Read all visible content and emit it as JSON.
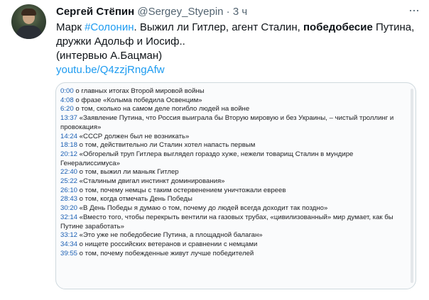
{
  "tweet": {
    "author_name": "Сергей Стёпин",
    "handle": "@Sergey_Styepin",
    "separator": "·",
    "time": "3 ч",
    "more_icon": "ellipsis-icon",
    "line1_a": "Марк ",
    "line1_hashtag": "#Солонин",
    "line1_b": ". Выжил ли Гитлер, агент Сталин, ",
    "line1_bold": "победобесие",
    "line1_c": " Путина,",
    "line2": "дружки Адольф и Иосиф..",
    "line3": "(интервью А.Бацман)",
    "link": "youtu.be/Q4zzjRngAfw"
  },
  "timestamps": [
    {
      "time": "0:00",
      "text": " о главных итогах Второй мировой войны"
    },
    {
      "time": "4:08",
      "text": " о фразе «Колыма победила Освенцим»"
    },
    {
      "time": "6:20",
      "text": " о том, сколько на самом деле погибло людей на войне"
    },
    {
      "time": "13:37",
      "text": " «Заявление Путина, что Россия выиграла бы Вторую мировую и без Украины, – чистый троллинг и провокация»"
    },
    {
      "time": "14:24",
      "text": " «СССР должен был не возникать»"
    },
    {
      "time": "18:18",
      "text": " о том, действительно ли Сталин хотел напасть первым"
    },
    {
      "time": "20:12",
      "text": " «Обгорелый труп Гитлера выглядел гораздо хуже, нежели товарищ Сталин в мундире Генералиссимуса»"
    },
    {
      "time": "22:40",
      "text": " о том, выжил ли маньяк Гитлер"
    },
    {
      "time": "25:22",
      "text": " «Сталиным двигал инстинкт доминирования»"
    },
    {
      "time": "26:10",
      "text": " о том, почему немцы с таким остервенением уничтожали евреев"
    },
    {
      "time": "28:43",
      "text": " о том, когда отмечать День Победы"
    },
    {
      "time": "30:20",
      "text": " «В День Победы я думаю о том, почему до людей всегда доходит так поздно»"
    },
    {
      "time": "32:14",
      "text": " «Вместо того, чтобы перекрыть вентили на газовых трубах, «цивилизованный» мир думает, как бы Путине заработать»"
    },
    {
      "time": "33:12",
      "text": " «Это уже не победобесие Путина, а площадной балаган»"
    },
    {
      "time": "34:34",
      "text": " о нищете российских ветеранов и сравнении с немцами"
    },
    {
      "time": "39:55",
      "text": " о том, почему побежденные живут лучше победителей"
    }
  ]
}
